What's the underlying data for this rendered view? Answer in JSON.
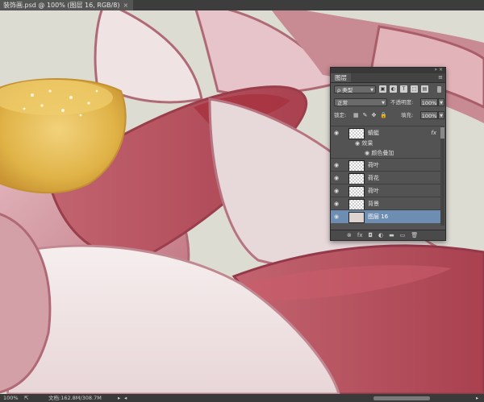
{
  "window": {
    "tab_title": "装饰画.psd @ 100% (图层 16, RGB/8)",
    "tab_close": "×"
  },
  "status": {
    "zoom": "100%",
    "doc_info": "文档:162.8M/308.7M",
    "arrow": "▸"
  },
  "layers_panel": {
    "tab_label": "图层",
    "menu_icon": "≡",
    "filter_select": "ρ 类型",
    "filter_icons": [
      "image-filter-icon",
      "adjustment-filter-icon",
      "type-filter-icon",
      "shape-filter-icon",
      "smart-object-filter-icon"
    ],
    "filter_glyphs": [
      "▣",
      "◐",
      "T",
      "⬚",
      "▤"
    ],
    "blend_mode": "正常",
    "opacity_label": "不透明度:",
    "opacity_value": "100%",
    "lock_label": "锁定:",
    "lock_glyphs": [
      "▦",
      "✎",
      "✥",
      "🔒"
    ],
    "fill_label": "填充:",
    "fill_value": "100%",
    "layers": [
      {
        "name": "蜻蜓",
        "fx": "fx"
      },
      {
        "name": "荷叶"
      },
      {
        "name": "荷花"
      },
      {
        "name": "荷叶"
      },
      {
        "name": "背景"
      },
      {
        "name": "图层 16",
        "selected": true
      }
    ],
    "effects_label": "效果",
    "effect_item": "颜色叠加",
    "footer_glyphs": [
      "⊗",
      "fx",
      "◘",
      "◐",
      "▬",
      "▭",
      "🗑"
    ],
    "eye": "👁"
  },
  "colors": {
    "selected_layer": "#6e8db2",
    "petal_pink": "#c98a94",
    "petal_deep": "#a8424f",
    "seedpod": "#e2b94a"
  }
}
